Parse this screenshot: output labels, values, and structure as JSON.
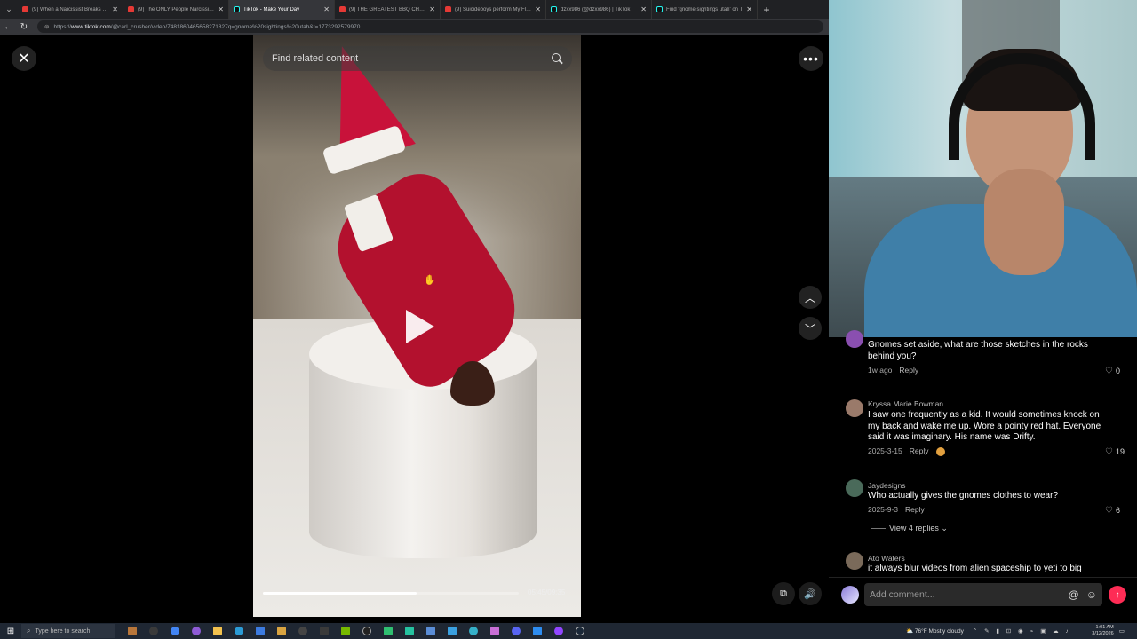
{
  "browser": {
    "tabs": [
      {
        "title": "(9) When a Narcissist Breaks the I",
        "icon": "youtube-icon",
        "active": false
      },
      {
        "title": "(9) The ONLY People Narcissists 3",
        "icon": "youtube-icon",
        "active": false
      },
      {
        "title": "TikTok - Make Your Day",
        "icon": "tiktok-icon",
        "active": true
      },
      {
        "title": "(9) THE GREATEST BBQ CHALLEN",
        "icon": "youtube-icon",
        "active": false
      },
      {
        "title": "(9) Suicideboys perform My Flaw",
        "icon": "youtube-icon",
        "active": false
      },
      {
        "title": "dzxx986 (@dzxx986) | TikTok",
        "icon": "tiktok-icon",
        "active": false
      },
      {
        "title": "Find 'gnome sightings utah' on T",
        "icon": "tiktok-icon",
        "active": false
      }
    ],
    "url_host": "www.tiktok.com",
    "url_path": "/@carl_crusher/video/7481860465658271827q=gnome%20sightings%20utah&t=1773292579970",
    "url_prefix": "https://"
  },
  "video": {
    "search_placeholder": "Find related content",
    "time": "05:45/09:35",
    "progress": 0.6
  },
  "comments": [
    {
      "user": "",
      "text": "Gnomes set aside, what are those sketches in the rocks behind you?",
      "date": "1w ago",
      "reply": "Reply",
      "likes": "0"
    },
    {
      "user": "Kryssa Marie Bowman",
      "text": "I saw one frequently as a kid. It would sometimes knock on my back and wake me up. Wore a pointy red hat. Everyone said it was imaginary. His name was Drifty.",
      "date": "2025-3-15",
      "reply": "Reply",
      "likes": "19"
    },
    {
      "user": "Jaydesigns",
      "text": "Who actually gives the gnomes clothes to wear?",
      "date": "2025-9-3",
      "reply": "Reply",
      "likes": "6",
      "view_replies": "View 4 replies"
    },
    {
      "user": "Ato Waters",
      "text": "it always blur videos from alien spaceship to yeti to big"
    }
  ],
  "comment_bar": {
    "placeholder": "Add comment..."
  },
  "taskbar": {
    "search_placeholder": "Type here to search",
    "weather": "76°F  Mostly cloudy",
    "time": "1:01 AM",
    "date": "3/12/2026"
  },
  "colors": {
    "accent": "#fe2c55",
    "shirt": "#3f7fa8"
  }
}
